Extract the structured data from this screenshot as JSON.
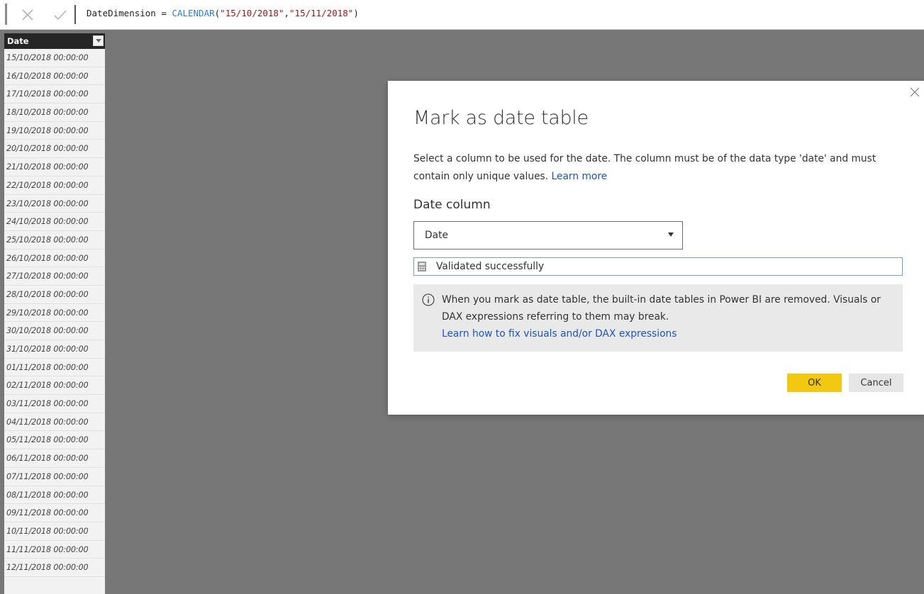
{
  "formula_bar": {
    "cancel_icon": "close-icon",
    "commit_icon": "checkmark-icon",
    "formula_prefix": "DateDimension = ",
    "formula_function": "CALENDAR",
    "formula_open": "(",
    "formula_arg1": "\"15/10/2018\"",
    "formula_sep": ",",
    "formula_arg2": "\"15/11/2018\"",
    "formula_close": ")"
  },
  "table": {
    "column_header": "Date",
    "filter_icon": "dropdown-arrow-icon",
    "rows": [
      "15/10/2018 00:00:00",
      "16/10/2018 00:00:00",
      "17/10/2018 00:00:00",
      "18/10/2018 00:00:00",
      "19/10/2018 00:00:00",
      "20/10/2018 00:00:00",
      "21/10/2018 00:00:00",
      "22/10/2018 00:00:00",
      "23/10/2018 00:00:00",
      "24/10/2018 00:00:00",
      "25/10/2018 00:00:00",
      "26/10/2018 00:00:00",
      "27/10/2018 00:00:00",
      "28/10/2018 00:00:00",
      "29/10/2018 00:00:00",
      "30/10/2018 00:00:00",
      "31/10/2018 00:00:00",
      "01/11/2018 00:00:00",
      "02/11/2018 00:00:00",
      "03/11/2018 00:00:00",
      "04/11/2018 00:00:00",
      "05/11/2018 00:00:00",
      "06/11/2018 00:00:00",
      "07/11/2018 00:00:00",
      "08/11/2018 00:00:00",
      "09/11/2018 00:00:00",
      "10/11/2018 00:00:00",
      "11/11/2018 00:00:00",
      "12/11/2018 00:00:00"
    ]
  },
  "dialog": {
    "title": "Mark as date table",
    "description": "Select a column to be used for the date. The column must be of the data type 'date' and must contain only unique values.",
    "description_link": "Learn more",
    "date_column_label": "Date column",
    "selected_column": "Date",
    "validation_text": "Validated successfully",
    "info_text": "When you mark as date table, the built-in date tables in Power BI are removed. Visuals or DAX expressions referring to them may break.",
    "info_link": "Learn how to fix visuals and/or DAX expressions",
    "ok_label": "OK",
    "cancel_label": "Cancel"
  },
  "colors": {
    "background": "#777777",
    "ok_button": "#f2c811",
    "link": "#1b55c4",
    "function": "#2f7bd4",
    "string": "#a31515"
  }
}
